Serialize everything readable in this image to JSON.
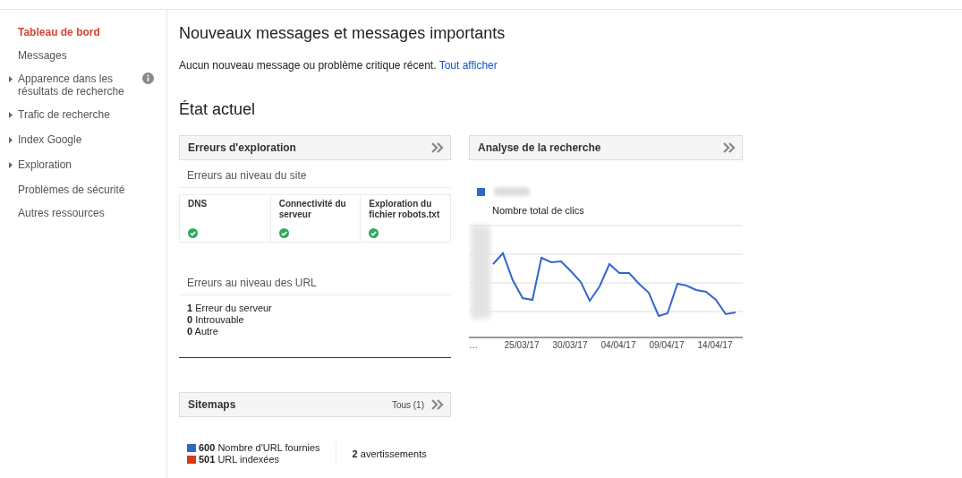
{
  "sidebar": {
    "items": [
      {
        "label": "Tableau de bord",
        "selected": true,
        "kind": "link",
        "info": false
      },
      {
        "label": "Messages",
        "selected": false,
        "kind": "link",
        "info": false
      },
      {
        "label": "Apparence dans les résultats de recherche",
        "selected": false,
        "kind": "group",
        "info": true
      },
      {
        "label": "Trafic de recherche",
        "selected": false,
        "kind": "group",
        "info": false
      },
      {
        "label": "Index Google",
        "selected": false,
        "kind": "group",
        "info": false
      },
      {
        "label": "Exploration",
        "selected": false,
        "kind": "group",
        "info": false
      },
      {
        "label": "Problèmes de sécurité",
        "selected": false,
        "kind": "link",
        "info": false
      },
      {
        "label": "Autres ressources",
        "selected": false,
        "kind": "link",
        "info": false
      }
    ]
  },
  "messages": {
    "title": "Nouveaux messages et messages importants",
    "text": "Aucun nouveau message ou problème critique récent.",
    "link": "Tout afficher"
  },
  "status": {
    "title": "État actuel",
    "crawl_errors": {
      "title": "Erreurs d'exploration",
      "site_heading": "Erreurs au niveau du site",
      "site_checks": [
        {
          "label": "DNS",
          "ok": true
        },
        {
          "label": "Connectivité du serveur",
          "ok": true
        },
        {
          "label": "Exploration du fichier robots.txt",
          "ok": true
        }
      ],
      "url_heading": "Erreurs au niveau des URL",
      "url_errors": [
        {
          "count": "1",
          "label": "Erreur du serveur"
        },
        {
          "count": "0",
          "label": "Introuvable"
        },
        {
          "count": "0",
          "label": "Autre"
        }
      ]
    },
    "search_analytics": {
      "title": "Analyse de la recherche",
      "legend": {
        "color": "#3366cc",
        "label": "Nombre total de clics"
      },
      "x_labels": [
        "…",
        "25/03/17",
        "30/03/17",
        "04/04/17",
        "09/04/17",
        "14/04/17"
      ]
    },
    "sitemaps": {
      "title": "Sitemaps",
      "all_link": "Tous (1)",
      "stats": [
        {
          "count": "600",
          "label": "Nombre d'URL fournies",
          "color": "#3366cc"
        },
        {
          "count": "501",
          "label": "URL indexées",
          "color": "#dc3912"
        }
      ],
      "warnings": {
        "count": "2",
        "label": "avertissements"
      }
    }
  }
}
